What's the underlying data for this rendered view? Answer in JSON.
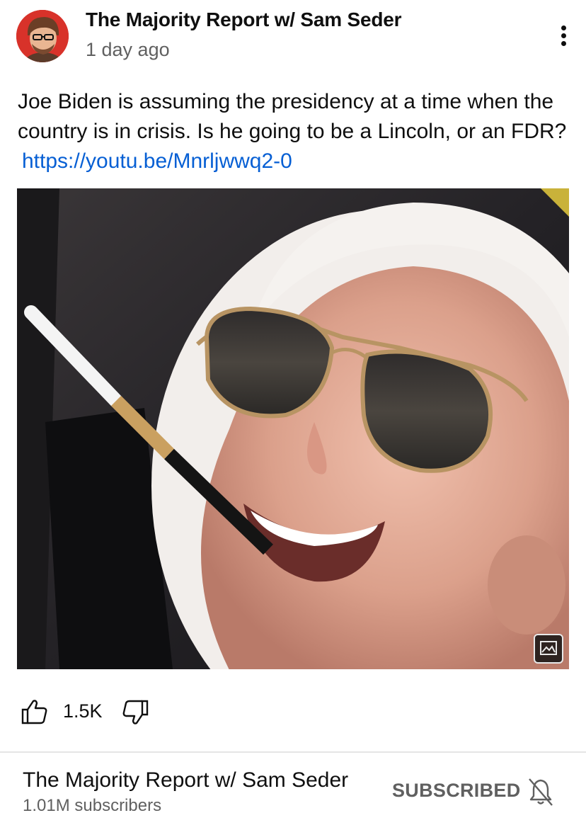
{
  "post": {
    "channel_name": "The Majority Report w/ Sam Seder",
    "time_ago": "1 day ago",
    "text": "Joe Biden is assuming the presidency at a time when the country is in crisis. Is he going to be a Lincoln, or an FDR?",
    "link_text": "https://youtu.be/Mnrljwwq2-0",
    "image_badge_icon": "image-gallery-icon"
  },
  "engagement": {
    "like_count": "1.5K",
    "like_icon": "thumbs-up-icon",
    "dislike_icon": "thumbs-down-icon"
  },
  "footer": {
    "channel_name": "The Majority Report w/ Sam Seder",
    "subscribers": "1.01M subscribers",
    "subscribed_label": "SUBSCRIBED",
    "bell_icon": "bell-off-icon"
  },
  "colors": {
    "link": "#065fd4",
    "secondary_text": "#606060",
    "avatar_bg": "#d8322a"
  }
}
